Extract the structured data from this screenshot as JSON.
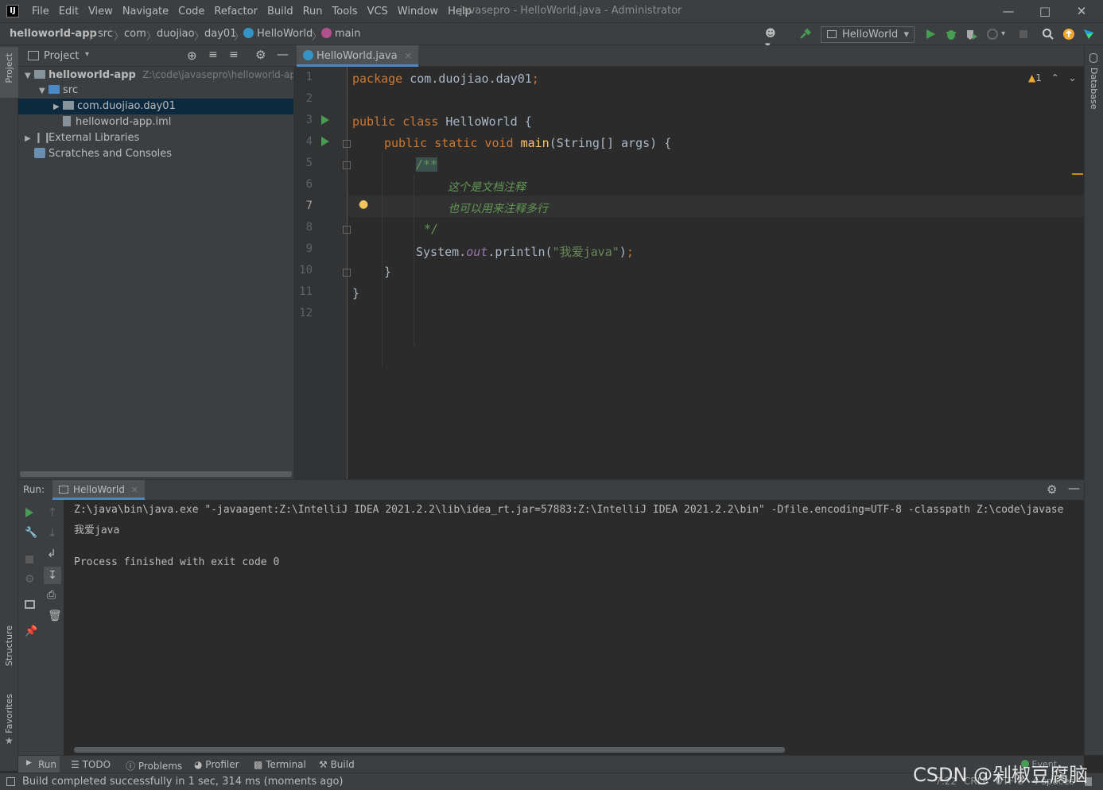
{
  "window": {
    "title": "javasepro - HelloWorld.java - Administrator",
    "logo": "IJ"
  },
  "menu": [
    "File",
    "Edit",
    "View",
    "Navigate",
    "Code",
    "Refactor",
    "Build",
    "Run",
    "Tools",
    "VCS",
    "Window",
    "Help"
  ],
  "breadcrumb": {
    "project": "helloworld-app",
    "items": [
      "src",
      "com",
      "duojiao",
      "day01",
      "HelloWorld",
      "main"
    ]
  },
  "toolbar": {
    "run_config": "HelloWorld"
  },
  "project_panel": {
    "title": "Project",
    "tree": [
      {
        "label": "helloworld-app",
        "path": "Z:\\code\\javasepro\\helloworld-app"
      },
      {
        "label": "src"
      },
      {
        "label": "com.duojiao.day01"
      },
      {
        "label": "helloworld-app.iml"
      },
      {
        "label": "External Libraries"
      },
      {
        "label": "Scratches and Consoles"
      }
    ]
  },
  "left_tools": {
    "project": "Project",
    "structure": "Structure",
    "favorites": "Favorites"
  },
  "right_tools": {
    "database": "Database"
  },
  "editor": {
    "tab": "HelloWorld.java",
    "warnings": "1",
    "line_numbers": [
      "1",
      "2",
      "3",
      "4",
      "5",
      "6",
      "7",
      "8",
      "9",
      "10",
      "11",
      "12"
    ],
    "lines": {
      "l1_kw": "package",
      "l1_rest": " com.duojiao.day01",
      "l1_semi": ";",
      "l3_kw": "public class",
      "l3_rest": " HelloWorld {",
      "l4_kw": "public static void",
      "l4_fn": "main",
      "l4_rest": "(String[] args) {",
      "l5_doc": "/**",
      "l6_doc": "这个是文档注释",
      "l7_doc": "也可以用来注释多行",
      "l8_doc": "*/",
      "l9_a": "System.",
      "l9_field": "out",
      "l9_b": ".println(",
      "l9_str": "\"我爱java\"",
      "l9_c": ")",
      "l9_semi": ";",
      "l10": "}",
      "l11": "}"
    }
  },
  "run_panel": {
    "label": "Run:",
    "tab": "HelloWorld",
    "console": [
      "Z:\\java\\bin\\java.exe \"-javaagent:Z:\\IntelliJ IDEA 2021.2.2\\lib\\idea_rt.jar=57883:Z:\\IntelliJ IDEA 2021.2.2\\bin\" -Dfile.encoding=UTF-8 -classpath Z:\\code\\javase",
      "我爱java",
      "",
      "Process finished with exit code 0"
    ]
  },
  "bottom_tabs": [
    "Run",
    "TODO",
    "Problems",
    "Profiler",
    "Terminal",
    "Build"
  ],
  "status": {
    "message": "Build completed successfully in 1 sec, 314 ms (moments ago)",
    "position": "7:22",
    "line_sep": "CRLF",
    "encoding": "UTF-8",
    "indent": "4 spaces",
    "event_log": "Event"
  },
  "watermark": "CSDN @剁椒豆腐脑",
  "colors": {
    "accent": "#4a88c7",
    "keyword": "#cc7832",
    "string": "#6a8759",
    "doc": "#629755",
    "run_green": "#499c54"
  }
}
